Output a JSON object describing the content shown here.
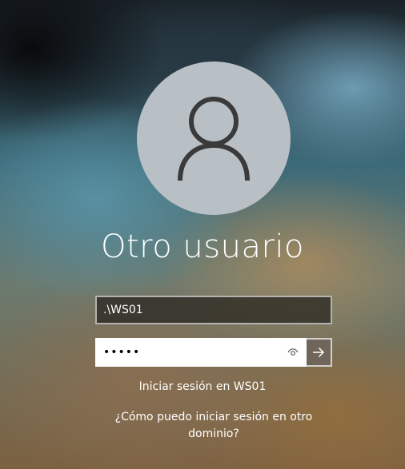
{
  "user": {
    "display_name": "Otro usuario",
    "avatar_icon": "person-icon"
  },
  "login": {
    "username_value": ".\\WS01",
    "password_value": "•••••",
    "reveal_icon": "eye-icon",
    "submit_icon": "arrow-right-icon"
  },
  "links": {
    "signin_to": "Iniciar sesión en WS01",
    "other_domain": "¿Cómo puedo iniciar sesión en otro dominio?"
  },
  "colors": {
    "avatar_bg": "#b8c0c6",
    "avatar_glyph": "#3a3a3a",
    "text": "#ffffff"
  }
}
